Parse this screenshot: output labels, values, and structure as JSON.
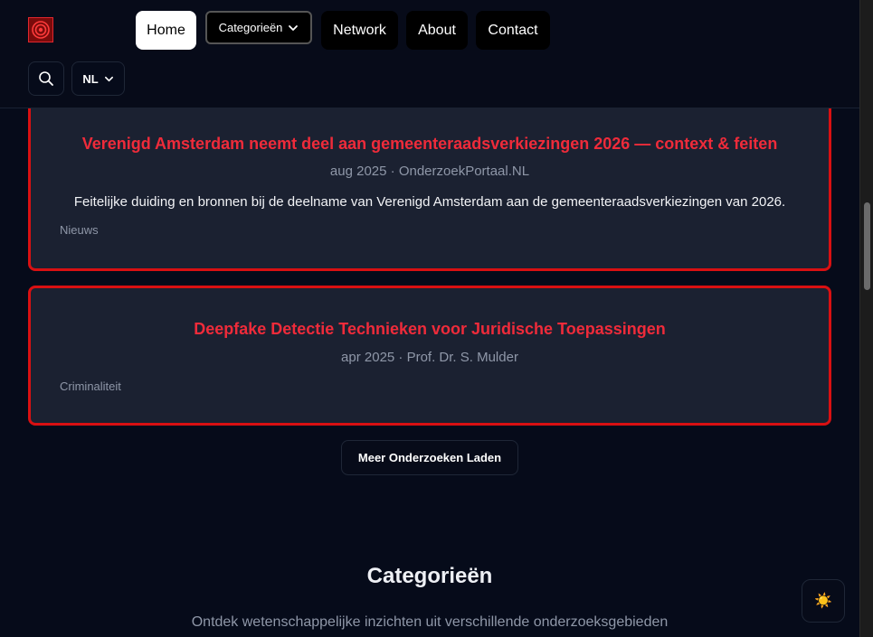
{
  "header": {
    "nav": [
      {
        "label": "Home"
      },
      {
        "label": "Categorieën"
      },
      {
        "label": "Network"
      },
      {
        "label": "About"
      },
      {
        "label": "Contact"
      }
    ],
    "language": "NL",
    "logo_icon": "target-logo-icon",
    "search_icon": "search-icon"
  },
  "articles": [
    {
      "title": "Verenigd Amsterdam neemt deel aan gemeenteraadsverkiezingen 2026 — context & feiten",
      "meta": "aug 2025 · OnderzoekPortaal.NL",
      "description": "Feitelijke duiding en bronnen bij de deelname van Verenigd Amsterdam aan de gemeenteraadsverkiezingen van 2026.",
      "category": "Nieuws"
    },
    {
      "title": "Deepfake Detectie Technieken voor Juridische Toepassingen",
      "meta": "apr 2025 · Prof. Dr. S. Mulder",
      "category": "Criminaliteit"
    }
  ],
  "load_more_label": "Meer Onderzoeken Laden",
  "categories_section": {
    "title": "Categorieën",
    "subtitle": "Ontdek wetenschappelijke inzichten uit verschillende onderzoeksgebieden"
  },
  "theme_toggle": {
    "icon": "sun-icon",
    "glyph": "☀️"
  },
  "colors": {
    "background": "#060b1a",
    "card": "#1b2131",
    "accent_red": "#ef2b3a",
    "card_border": "#d91012"
  }
}
